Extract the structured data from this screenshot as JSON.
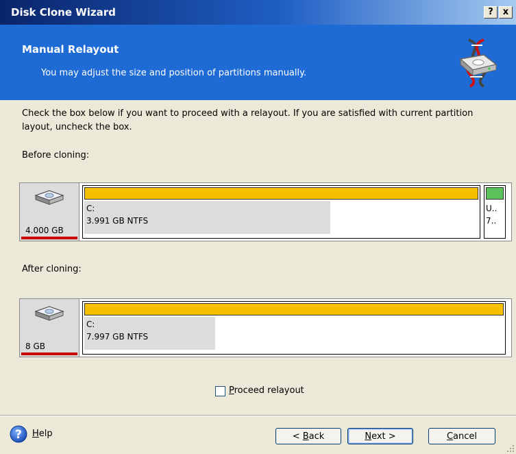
{
  "window": {
    "title": "Disk Clone Wizard",
    "help_button": "?",
    "close_button": "x"
  },
  "header": {
    "title": "Manual Relayout",
    "subtitle": "You may adjust the size and position of partitions manually."
  },
  "instructions": "Check the box below if you want to proceed with a relayout. If you are satisfied with current partition layout, uncheck the box.",
  "before": {
    "label": "Before cloning:",
    "disk_size": "4.000 GB",
    "partition_letter": "C:",
    "partition_info": "3.991 GB  NTFS",
    "used_fraction": 0.62,
    "small_partition_line1": "U..",
    "small_partition_line2": "7.."
  },
  "after": {
    "label": "After cloning:",
    "disk_size": "8 GB",
    "partition_letter": "C:",
    "partition_info": "7.997 GB  NTFS",
    "used_fraction": 0.31
  },
  "checkbox": {
    "label_first": "P",
    "label_rest": "roceed relayout",
    "checked": false
  },
  "footer": {
    "help_first": "H",
    "help_rest": "elp",
    "back_pre": "< ",
    "back_first": "B",
    "back_rest": "ack",
    "next_first": "N",
    "next_rest": "ext >",
    "cancel_first": "C",
    "cancel_rest": "ancel"
  },
  "colors": {
    "header_bg": "#1e6bd6",
    "partition_bar": "#f5c000",
    "unallocated_bar": "#5cc35c",
    "disk_underline": "#cc0000"
  },
  "icons": {
    "titlebar_help": "help-icon",
    "titlebar_close": "close-icon",
    "wizard_logo": "disk-clone-logo",
    "disk": "hard-disk-icon",
    "help": "question-circle-icon",
    "grip": "resize-grip-icon"
  }
}
